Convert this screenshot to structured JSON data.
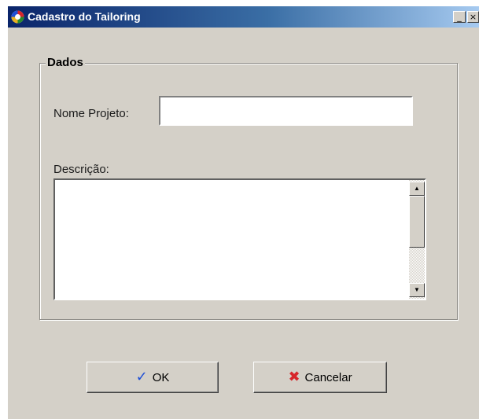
{
  "window": {
    "title": "Cadastro do Tailoring",
    "minimize_glyph": "_",
    "close_glyph": "×",
    "icon": "app-logo-icon"
  },
  "group": {
    "title": "Dados"
  },
  "form": {
    "nome_label": "Nome Projeto:",
    "nome_value": "",
    "descricao_label": "Descrição:",
    "descricao_value": ""
  },
  "scrollbar": {
    "up_glyph": "▲",
    "down_glyph": "▼"
  },
  "buttons": {
    "ok_label": "OK",
    "ok_icon": "checkmark-icon",
    "ok_glyph": "✓",
    "cancel_label": "Cancelar",
    "cancel_icon": "x-icon",
    "cancel_glyph": "✖"
  },
  "colors": {
    "titlebar_start": "#0a246a",
    "titlebar_end": "#a6caf0",
    "dialog_bg": "#d4d0c8",
    "ok_icon": "#1f4fd6",
    "cancel_icon": "#d7262b"
  }
}
